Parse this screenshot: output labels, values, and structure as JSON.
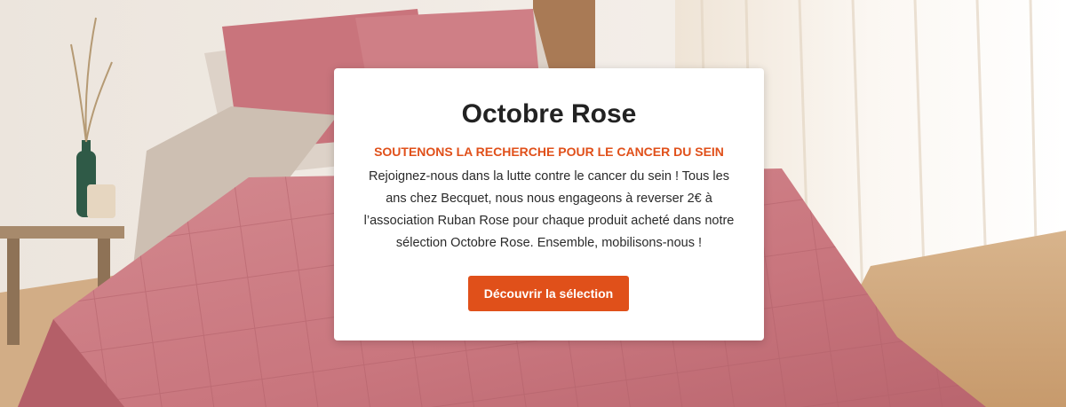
{
  "promo": {
    "title": "Octobre Rose",
    "subtitle": "SOUTENONS LA RECHERCHE POUR LE CANCER DU SEIN",
    "body": "Rejoignez-nous dans la lutte contre le cancer du sein ! Tous les ans chez Becquet, nous nous engageons à reverser 2€ à l’association Ruban Rose pour chaque produit acheté dans notre sélection Octobre Rose. Ensemble, mobilisons-nous !",
    "cta_label": "Découvrir la sélection"
  },
  "colors": {
    "accent": "#e0501a",
    "bedding_pink": "#c97880",
    "card_background": "#ffffff"
  }
}
